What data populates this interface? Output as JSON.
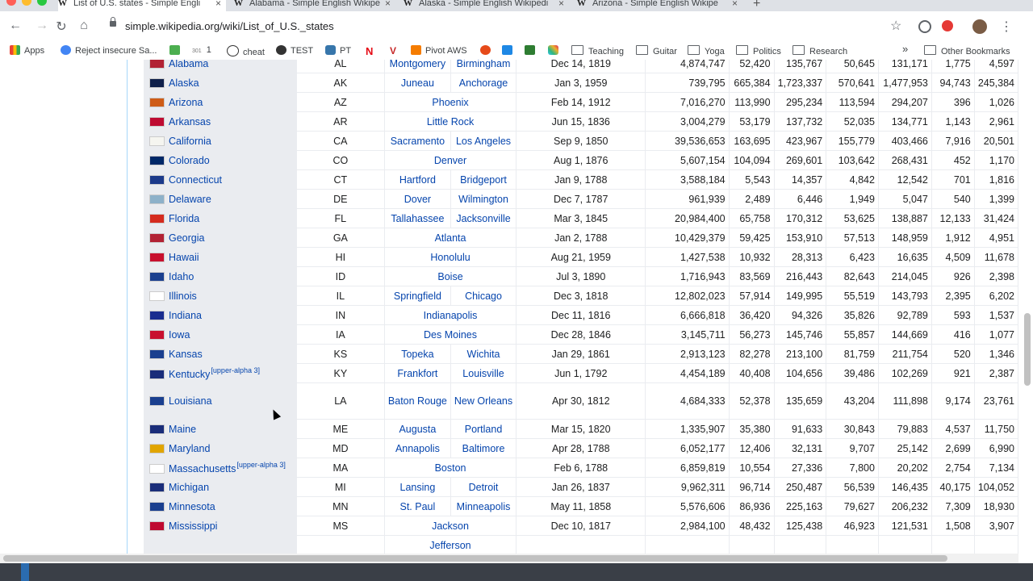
{
  "browser": {
    "tabs": [
      {
        "title": "List of U.S. states - Simple Engli"
      },
      {
        "title": "Alabama - Simple English Wikipe"
      },
      {
        "title": "Alaska - Simple English Wikipedi"
      },
      {
        "title": "Arizona - Simple English Wikipe"
      }
    ],
    "url": "simple.wikipedia.org/wiki/List_of_U.S._states",
    "bookmarks": [
      {
        "label": "Apps"
      },
      {
        "label": "Reject insecure Sa..."
      },
      {
        "label": "1"
      },
      {
        "label": "cheat"
      },
      {
        "label": "TEST"
      },
      {
        "label": "PT"
      },
      {
        "label": "Pivot AWS"
      },
      {
        "label": "Teaching"
      },
      {
        "label": "Guitar"
      },
      {
        "label": "Yoga"
      },
      {
        "label": "Politics"
      },
      {
        "label": "Research"
      },
      {
        "label": "»"
      },
      {
        "label": "Other Bookmarks"
      }
    ]
  },
  "table": {
    "rows": [
      {
        "state": "Alabama",
        "note": "",
        "abbr": "AL",
        "capital": "Montgomery",
        "largest": "Birmingham",
        "date": "Dec 14, 1819",
        "n": [
          "4,874,747",
          "52,420",
          "135,767",
          "50,645",
          "131,171",
          "1,775",
          "4,597"
        ],
        "flag": "#b22234"
      },
      {
        "state": "Alaska",
        "note": "",
        "abbr": "AK",
        "capital": "Juneau",
        "largest": "Anchorage",
        "date": "Jan 3, 1959",
        "n": [
          "739,795",
          "665,384",
          "1,723,337",
          "570,641",
          "1,477,953",
          "94,743",
          "245,384"
        ],
        "flag": "#0f204b"
      },
      {
        "state": "Arizona",
        "note": "",
        "abbr": "AZ",
        "capital": "Phoenix",
        "largest": "",
        "date": "Feb 14, 1912",
        "n": [
          "7,016,270",
          "113,990",
          "295,234",
          "113,594",
          "294,207",
          "396",
          "1,026"
        ],
        "flag": "#ce5c17"
      },
      {
        "state": "Arkansas",
        "note": "",
        "abbr": "AR",
        "capital": "Little Rock",
        "largest": "",
        "date": "Jun 15, 1836",
        "n": [
          "3,004,279",
          "53,179",
          "137,732",
          "52,035",
          "134,771",
          "1,143",
          "2,961"
        ],
        "flag": "#be0b31"
      },
      {
        "state": "California",
        "note": "",
        "abbr": "CA",
        "capital": "Sacramento",
        "largest": "Los Angeles",
        "date": "Sep 9, 1850",
        "n": [
          "39,536,653",
          "163,695",
          "423,967",
          "155,779",
          "403,466",
          "7,916",
          "20,501"
        ],
        "flag": "#f5f5f0"
      },
      {
        "state": "Colorado",
        "note": "",
        "abbr": "CO",
        "capital": "Denver",
        "largest": "",
        "date": "Aug 1, 1876",
        "n": [
          "5,607,154",
          "104,094",
          "269,601",
          "103,642",
          "268,431",
          "452",
          "1,170"
        ],
        "flag": "#002868"
      },
      {
        "state": "Connecticut",
        "note": "",
        "abbr": "CT",
        "capital": "Hartford",
        "largest": "Bridgeport",
        "date": "Jan 9, 1788",
        "n": [
          "3,588,184",
          "5,543",
          "14,357",
          "4,842",
          "12,542",
          "701",
          "1,816"
        ],
        "flag": "#1b3a8a"
      },
      {
        "state": "Delaware",
        "note": "",
        "abbr": "DE",
        "capital": "Dover",
        "largest": "Wilmington",
        "date": "Dec 7, 1787",
        "n": [
          "961,939",
          "2,489",
          "6,446",
          "1,949",
          "5,047",
          "540",
          "1,399"
        ],
        "flag": "#8db1c9"
      },
      {
        "state": "Florida",
        "note": "",
        "abbr": "FL",
        "capital": "Tallahassee",
        "largest": "Jacksonville",
        "date": "Mar 3, 1845",
        "n": [
          "20,984,400",
          "65,758",
          "170,312",
          "53,625",
          "138,887",
          "12,133",
          "31,424"
        ],
        "flag": "#d52b1e"
      },
      {
        "state": "Georgia",
        "note": "",
        "abbr": "GA",
        "capital": "Atlanta",
        "largest": "",
        "date": "Jan 2, 1788",
        "n": [
          "10,429,379",
          "59,425",
          "153,910",
          "57,513",
          "148,959",
          "1,912",
          "4,951"
        ],
        "flag": "#b22234"
      },
      {
        "state": "Hawaii",
        "note": "",
        "abbr": "HI",
        "capital": "Honolulu",
        "largest": "",
        "date": "Aug 21, 1959",
        "n": [
          "1,427,538",
          "10,932",
          "28,313",
          "6,423",
          "16,635",
          "4,509",
          "11,678"
        ],
        "flag": "#c8102e"
      },
      {
        "state": "Idaho",
        "note": "",
        "abbr": "ID",
        "capital": "Boise",
        "largest": "",
        "date": "Jul 3, 1890",
        "n": [
          "1,716,943",
          "83,569",
          "216,443",
          "82,643",
          "214,045",
          "926",
          "2,398"
        ],
        "flag": "#1a3f8f"
      },
      {
        "state": "Illinois",
        "note": "",
        "abbr": "IL",
        "capital": "Springfield",
        "largest": "Chicago",
        "date": "Dec 3, 1818",
        "n": [
          "12,802,023",
          "57,914",
          "149,995",
          "55,519",
          "143,793",
          "2,395",
          "6,202"
        ],
        "flag": "#ffffff"
      },
      {
        "state": "Indiana",
        "note": "",
        "abbr": "IN",
        "capital": "Indianapolis",
        "largest": "",
        "date": "Dec 11, 1816",
        "n": [
          "6,666,818",
          "36,420",
          "94,326",
          "35,826",
          "92,789",
          "593",
          "1,537"
        ],
        "flag": "#1a2d8f"
      },
      {
        "state": "Iowa",
        "note": "",
        "abbr": "IA",
        "capital": "Des Moines",
        "largest": "",
        "date": "Dec 28, 1846",
        "n": [
          "3,145,711",
          "56,273",
          "145,746",
          "55,857",
          "144,669",
          "416",
          "1,077"
        ],
        "flag": "#c8102e"
      },
      {
        "state": "Kansas",
        "note": "",
        "abbr": "KS",
        "capital": "Topeka",
        "largest": "Wichita",
        "date": "Jan 29, 1861",
        "n": [
          "2,913,123",
          "82,278",
          "213,100",
          "81,759",
          "211,754",
          "520",
          "1,346"
        ],
        "flag": "#1a3f8f"
      },
      {
        "state": "Kentucky",
        "note": "[upper-alpha 3]",
        "abbr": "KY",
        "capital": "Frankfort",
        "largest": "Louisville",
        "date": "Jun 1, 1792",
        "n": [
          "4,454,189",
          "40,408",
          "104,656",
          "39,486",
          "102,269",
          "921",
          "2,387"
        ],
        "flag": "#1a2d7a"
      },
      {
        "state": "Louisiana",
        "note": "",
        "abbr": "LA",
        "capital": "Baton Rouge",
        "largest": "New Orleans",
        "date": "Apr 30, 1812",
        "n": [
          "4,684,333",
          "52,378",
          "135,659",
          "43,204",
          "111,898",
          "9,174",
          "23,761"
        ],
        "flag": "#1a3f8f",
        "tall": true
      },
      {
        "state": "Maine",
        "note": "",
        "abbr": "ME",
        "capital": "Augusta",
        "largest": "Portland",
        "date": "Mar 15, 1820",
        "n": [
          "1,335,907",
          "35,380",
          "91,633",
          "30,843",
          "79,883",
          "4,537",
          "11,750"
        ],
        "flag": "#1a2d7a"
      },
      {
        "state": "Maryland",
        "note": "",
        "abbr": "MD",
        "capital": "Annapolis",
        "largest": "Baltimore",
        "date": "Apr 28, 1788",
        "n": [
          "6,052,177",
          "12,406",
          "32,131",
          "9,707",
          "25,142",
          "2,699",
          "6,990"
        ],
        "flag": "#e1a500"
      },
      {
        "state": "Massachusetts",
        "note": "[upper-alpha 3]",
        "abbr": "MA",
        "capital": "Boston",
        "largest": "",
        "date": "Feb 6, 1788",
        "n": [
          "6,859,819",
          "10,554",
          "27,336",
          "7,800",
          "20,202",
          "2,754",
          "7,134"
        ],
        "flag": "#ffffff"
      },
      {
        "state": "Michigan",
        "note": "",
        "abbr": "MI",
        "capital": "Lansing",
        "largest": "Detroit",
        "date": "Jan 26, 1837",
        "n": [
          "9,962,311",
          "96,714",
          "250,487",
          "56,539",
          "146,435",
          "40,175",
          "104,052"
        ],
        "flag": "#1a2d7a"
      },
      {
        "state": "Minnesota",
        "note": "",
        "abbr": "MN",
        "capital": "St. Paul",
        "largest": "Minneapolis",
        "date": "May 11, 1858",
        "n": [
          "5,576,606",
          "86,936",
          "225,163",
          "79,627",
          "206,232",
          "7,309",
          "18,930"
        ],
        "flag": "#1a3f8f"
      },
      {
        "state": "Mississippi",
        "note": "",
        "abbr": "MS",
        "capital": "Jackson",
        "largest": "",
        "date": "Dec 10, 1817",
        "n": [
          "2,984,100",
          "48,432",
          "125,438",
          "46,923",
          "121,531",
          "1,508",
          "3,907"
        ],
        "flag": "#bf0a30"
      },
      {
        "state": "",
        "note": "",
        "abbr": "",
        "capital": "Jefferson",
        "largest": "",
        "date": "",
        "n": [
          "",
          "",
          "",
          "",
          "",
          "",
          ""
        ],
        "flag": "#ffffff"
      }
    ]
  }
}
